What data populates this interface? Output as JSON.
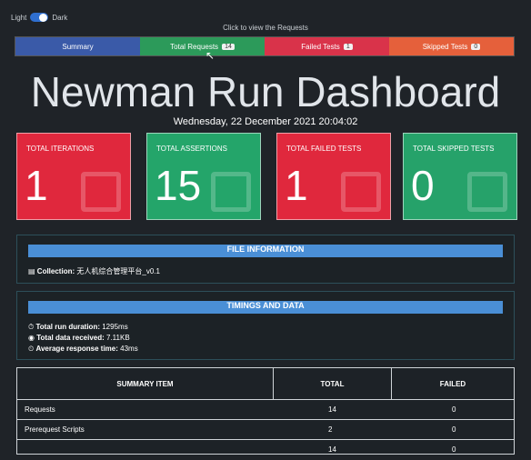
{
  "theme": {
    "light_label": "Light",
    "dark_label": "Dark"
  },
  "hint_text": "Click to view the Requests",
  "tabs": [
    {
      "label": "Summary",
      "badge": ""
    },
    {
      "label": "Total Requests",
      "badge": "14"
    },
    {
      "label": "Failed Tests",
      "badge": "1"
    },
    {
      "label": "Skipped Tests",
      "badge": "0"
    }
  ],
  "title": "Newman Run Dashboard",
  "datetime": "Wednesday, 22 December 2021 20:04:02",
  "cards": [
    {
      "label": "TOTAL ITERATIONS",
      "value": "1"
    },
    {
      "label": "TOTAL ASSERTIONS",
      "value": "15"
    },
    {
      "label": "TOTAL FAILED TESTS",
      "value": "1"
    },
    {
      "label": "TOTAL SKIPPED TESTS",
      "value": "0"
    }
  ],
  "file_info": {
    "heading": "FILE INFORMATION",
    "collection_label": "Collection:",
    "collection_value": "无人机综合管理平台_v0.1"
  },
  "timings": {
    "heading": "TIMINGS AND DATA",
    "duration_label": "Total run duration:",
    "duration_value": "1295ms",
    "data_label": "Total data received:",
    "data_value": "7.11KB",
    "response_label": "Average response time:",
    "response_value": "43ms"
  },
  "summary_table": {
    "headers": [
      "SUMMARY ITEM",
      "TOTAL",
      "FAILED"
    ],
    "rows": [
      {
        "item": "Requests",
        "total": "14",
        "failed": "0"
      },
      {
        "item": "Prerequest Scripts",
        "total": "2",
        "failed": "0"
      },
      {
        "item": "",
        "total": "14",
        "failed": "0"
      }
    ]
  },
  "colors": {
    "summary": "#3a5aa8",
    "requests": "#2c9a5a",
    "failed": "#d9334a",
    "skipped": "#e5603b",
    "card_red": "#e0283d",
    "card_green": "#24a56a",
    "panel_head": "#4a8fd6"
  }
}
